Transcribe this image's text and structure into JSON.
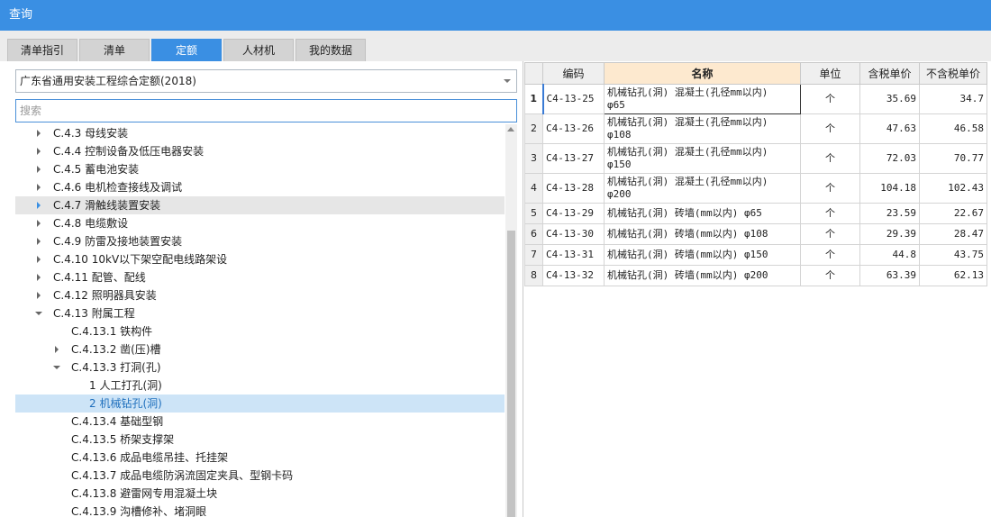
{
  "window": {
    "title": "查询"
  },
  "tabs": [
    {
      "label": "清单指引",
      "active": false
    },
    {
      "label": "清单",
      "active": false
    },
    {
      "label": "定额",
      "active": true
    },
    {
      "label": "人材机",
      "active": false
    },
    {
      "label": "我的数据",
      "active": false
    }
  ],
  "left": {
    "library_select": "广东省通用安装工程综合定额(2018)",
    "search_placeholder": "搜索",
    "tree": [
      {
        "label": "C.4.3 母线安装",
        "level": 1,
        "arrow": "right"
      },
      {
        "label": "C.4.4 控制设备及低压电器安装",
        "level": 1,
        "arrow": "right"
      },
      {
        "label": "C.4.5 蓄电池安装",
        "level": 1,
        "arrow": "right"
      },
      {
        "label": "C.4.6 电机检查接线及调试",
        "level": 1,
        "arrow": "right"
      },
      {
        "label": "C.4.7 滑触线装置安装",
        "level": 1,
        "arrow": "right-blue",
        "state": "hover"
      },
      {
        "label": "C.4.8 电缆敷设",
        "level": 1,
        "arrow": "right"
      },
      {
        "label": "C.4.9 防雷及接地装置安装",
        "level": 1,
        "arrow": "right"
      },
      {
        "label": "C.4.10 10kV以下架空配电线路架设",
        "level": 1,
        "arrow": "right"
      },
      {
        "label": "C.4.11 配管、配线",
        "level": 1,
        "arrow": "right"
      },
      {
        "label": "C.4.12 照明器具安装",
        "level": 1,
        "arrow": "right"
      },
      {
        "label": "C.4.13 附属工程",
        "level": 1,
        "arrow": "down"
      },
      {
        "label": "C.4.13.1 铁构件",
        "level": 2,
        "arrow": "none"
      },
      {
        "label": "C.4.13.2 凿(压)槽",
        "level": 2,
        "arrow": "right"
      },
      {
        "label": "C.4.13.3 打洞(孔)",
        "level": 2,
        "arrow": "down"
      },
      {
        "label": "1 人工打孔(洞)",
        "level": 3,
        "arrow": "none"
      },
      {
        "label": "2 机械钻孔(洞)",
        "level": 3,
        "arrow": "none",
        "state": "selected"
      },
      {
        "label": "C.4.13.4 基础型钢",
        "level": 2,
        "arrow": "none"
      },
      {
        "label": "C.4.13.5 桥架支撑架",
        "level": 2,
        "arrow": "none"
      },
      {
        "label": "C.4.13.6 成品电缆吊挂、托挂架",
        "level": 2,
        "arrow": "none"
      },
      {
        "label": "C.4.13.7 成品电缆防涡流固定夹具、型钢卡码",
        "level": 2,
        "arrow": "none"
      },
      {
        "label": "C.4.13.8 避雷网专用混凝土块",
        "level": 2,
        "arrow": "none"
      },
      {
        "label": "C.4.13.9 沟槽修补、堵洞眼",
        "level": 2,
        "arrow": "none"
      }
    ]
  },
  "grid": {
    "headers": [
      "",
      "编码",
      "名称",
      "单位",
      "含税单价",
      "不含税单价"
    ],
    "rows": [
      {
        "no": "1",
        "code": "C4-13-25",
        "name1": "机械钻孔(洞) 混凝土(孔径mm以内)",
        "name2": "φ65",
        "unit": "个",
        "price_tax": "35.69",
        "price_notax": "34.7",
        "current": true
      },
      {
        "no": "2",
        "code": "C4-13-26",
        "name1": "机械钻孔(洞) 混凝土(孔径mm以内)",
        "name2": "φ108",
        "unit": "个",
        "price_tax": "47.63",
        "price_notax": "46.58"
      },
      {
        "no": "3",
        "code": "C4-13-27",
        "name1": "机械钻孔(洞) 混凝土(孔径mm以内)",
        "name2": "φ150",
        "unit": "个",
        "price_tax": "72.03",
        "price_notax": "70.77"
      },
      {
        "no": "4",
        "code": "C4-13-28",
        "name1": "机械钻孔(洞) 混凝土(孔径mm以内)",
        "name2": "φ200",
        "unit": "个",
        "price_tax": "104.18",
        "price_notax": "102.43"
      },
      {
        "no": "5",
        "code": "C4-13-29",
        "name1": "机械钻孔(洞) 砖墙(mm以内) φ65",
        "name2": "",
        "unit": "个",
        "price_tax": "23.59",
        "price_notax": "22.67"
      },
      {
        "no": "6",
        "code": "C4-13-30",
        "name1": "机械钻孔(洞) 砖墙(mm以内) φ108",
        "name2": "",
        "unit": "个",
        "price_tax": "29.39",
        "price_notax": "28.47"
      },
      {
        "no": "7",
        "code": "C4-13-31",
        "name1": "机械钻孔(洞) 砖墙(mm以内) φ150",
        "name2": "",
        "unit": "个",
        "price_tax": "44.8",
        "price_notax": "43.75"
      },
      {
        "no": "8",
        "code": "C4-13-32",
        "name1": "机械钻孔(洞) 砖墙(mm以内) φ200",
        "name2": "",
        "unit": "个",
        "price_tax": "63.39",
        "price_notax": "62.13"
      }
    ]
  }
}
